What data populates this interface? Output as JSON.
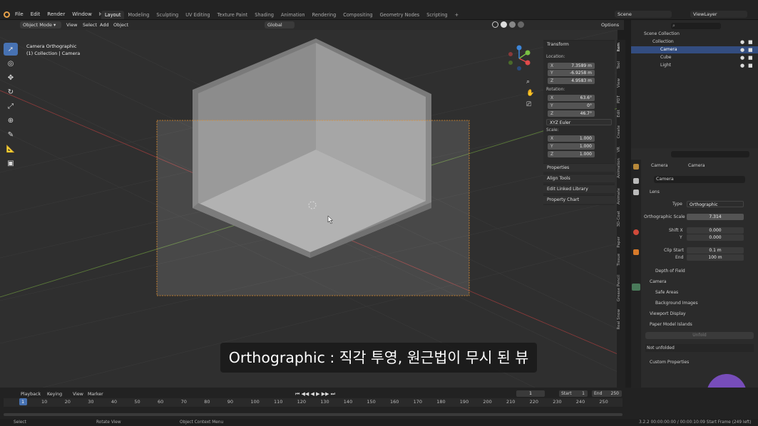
{
  "menu": {
    "items": [
      "File",
      "Edit",
      "Render",
      "Window",
      "Help"
    ]
  },
  "workspaces": {
    "tabs": [
      "Layout",
      "Modeling",
      "Sculpting",
      "UV Editing",
      "Texture Paint",
      "Shading",
      "Animation",
      "Rendering",
      "Compositing",
      "Geometry Nodes",
      "Scripting"
    ]
  },
  "scene": {
    "name": "Scene",
    "view_layer": "ViewLayer"
  },
  "viewport_header": {
    "mode": "Object Mode",
    "view": "View",
    "select": "Select",
    "add": "Add",
    "object": "Object",
    "orientation": "Global",
    "options": "Options"
  },
  "viewport": {
    "view_name": "Camera Orthographic",
    "collection_info": "(1) Collection | Camera"
  },
  "npanel": {
    "transform": "Transform",
    "location_label": "Location:",
    "loc": {
      "x": "7.3589 m",
      "y": "-6.9258 m",
      "z": "4.9583 m"
    },
    "rotation_label": "Rotation:",
    "rot": {
      "x": "63.6°",
      "y": "0°",
      "z": "46.7°"
    },
    "rot_mode": "XYZ Euler",
    "scale_label": "Scale:",
    "scale": {
      "x": "1.000",
      "y": "1.000",
      "z": "1.000"
    },
    "axis": {
      "x": "X",
      "y": "Y",
      "z": "Z"
    },
    "sections": [
      "Properties",
      "Align Tools",
      "Edit Linked Library",
      "Property Chart"
    ]
  },
  "panel_tabs": [
    "Item",
    "Tool",
    "View",
    "PDT",
    "Edit",
    "Create",
    "VR",
    "Animation",
    "Animate",
    "3D-Coat",
    "Paper",
    "Tissue",
    "Grease Pencil",
    "Real Snow"
  ],
  "outliner": {
    "scene_collection": "Scene Collection",
    "collection": "Collection",
    "items": [
      "Camera",
      "Cube",
      "Light"
    ]
  },
  "properties": {
    "breadcrumb_a": "Camera",
    "breadcrumb_b": "Camera",
    "data_name": "Camera",
    "lens_header": "Lens",
    "type_label": "Type",
    "type_value": "Orthographic",
    "ortho_scale_label": "Orthographic Scale",
    "ortho_scale_value": "7.314",
    "shift_x_label": "Shift X",
    "shift_x_value": "0.000",
    "shift_y_label": "Y",
    "shift_y_value": "0.000",
    "clip_start_label": "Clip Start",
    "clip_start_value": "0.1 m",
    "clip_end_label": "End",
    "clip_end_value": "100 m",
    "sections": [
      "Depth of Field",
      "Camera",
      "Safe Areas",
      "Background Images",
      "Viewport Display"
    ],
    "paper_model": "Paper Model Islands",
    "unfold": "Unfold",
    "not_unfolded": "Not unfolded",
    "custom_properties": "Custom Properties"
  },
  "timeline": {
    "playback": "Playback",
    "keying": "Keying",
    "view": "View",
    "marker": "Marker",
    "current_frame": "1",
    "start_label": "Start",
    "start": "1",
    "end_label": "End",
    "end": "250",
    "ticks": [
      "1",
      "10",
      "20",
      "30",
      "40",
      "50",
      "60",
      "70",
      "80",
      "90",
      "100",
      "110",
      "120",
      "130",
      "140",
      "150",
      "160",
      "170",
      "180",
      "190",
      "200",
      "210",
      "220",
      "230",
      "240",
      "250"
    ]
  },
  "status": {
    "select": "Select",
    "rotate": "Rotate View",
    "context": "Object Context Menu",
    "info": "3.2.2  00:00:00:00 / 00:00:10:09  Start Frame (249 left)"
  },
  "subtitle": "Orthographic : 직각 투영, 원근법이 무시 된 뷰",
  "colors": {
    "accent": "#4772b3",
    "camera_frame": "#e8902a",
    "x_axis": "#e04a4a",
    "y_axis": "#7ac043",
    "z_axis": "#3d86d8"
  }
}
